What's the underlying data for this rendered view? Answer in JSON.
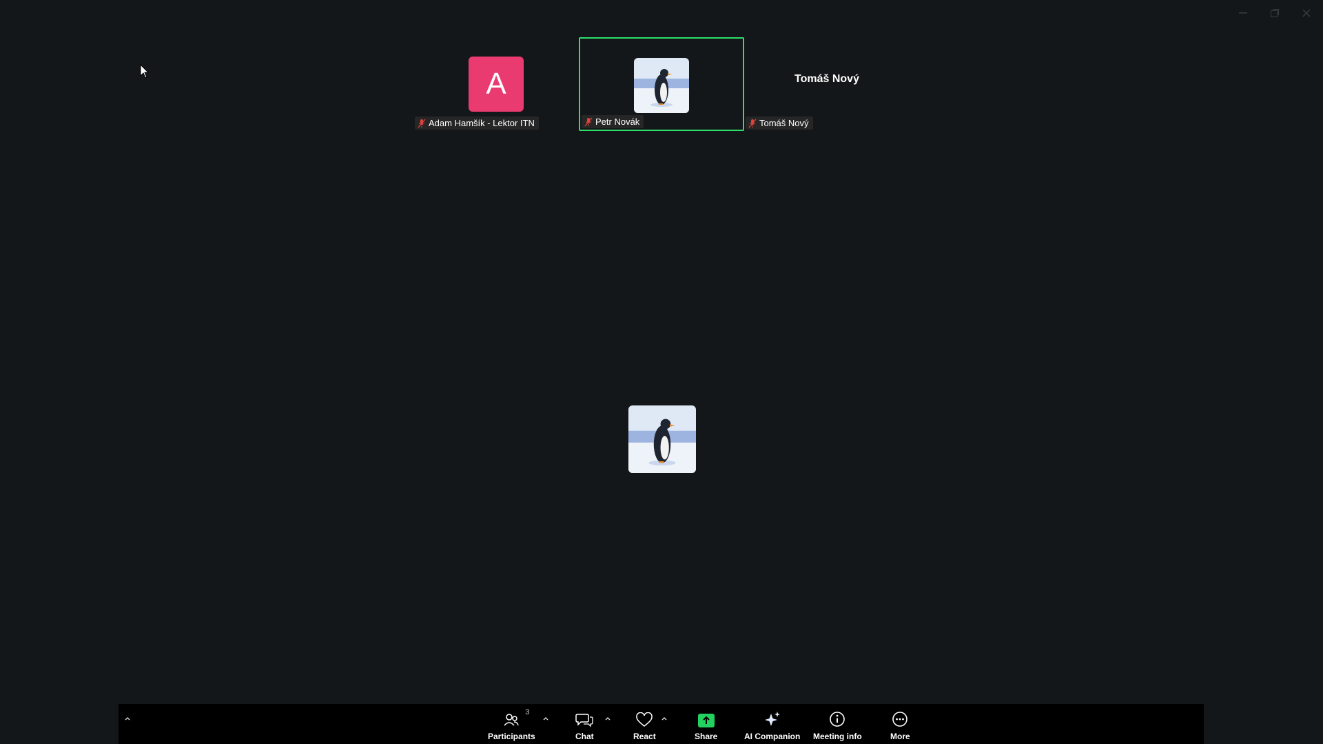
{
  "window": {
    "controls": {
      "minimize": "–",
      "restore": "❐",
      "close": "✕"
    }
  },
  "participants_tiles": [
    {
      "name": "Adam Hamšík - Lektor ITN",
      "avatar_letter": "A",
      "avatar_color": "#ea3b71",
      "muted": true,
      "active": false
    },
    {
      "name": "Petr Novák",
      "avatar": "penguin-image",
      "muted": true,
      "active": true
    },
    {
      "name": "Tomáš Nový",
      "display_name": "Tomáš Nový",
      "muted": true,
      "active": false
    }
  ],
  "self_view": {
    "avatar": "penguin-image"
  },
  "toolbar": {
    "participants": {
      "label": "Participants",
      "count": "3"
    },
    "chat": {
      "label": "Chat"
    },
    "react": {
      "label": "React"
    },
    "share": {
      "label": "Share",
      "color": "#22d15f"
    },
    "ai_companion": {
      "label": "AI Companion"
    },
    "meeting_info": {
      "label": "Meeting info"
    },
    "more": {
      "label": "More"
    }
  },
  "colors": {
    "background": "#141719",
    "active_speaker_border": "#2ee06a",
    "toolbar_bg": "#000000"
  }
}
